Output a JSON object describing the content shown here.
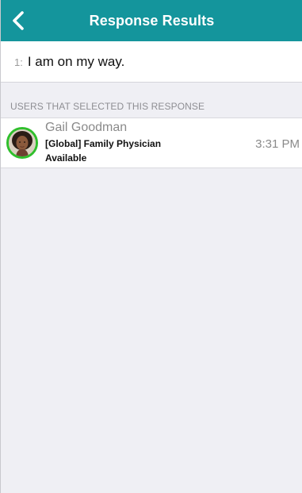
{
  "header": {
    "title": "Response Results",
    "back_icon": "chevron-left-icon",
    "background_color": "#14959c"
  },
  "response": {
    "number": "1:",
    "text": "I am on my way."
  },
  "section": {
    "label": "USERS THAT SELECTED THIS RESPONSE"
  },
  "users": [
    {
      "name": "Gail Goodman",
      "role": "[Global] Family Physician",
      "status": "Available",
      "status_color": "#2fbf2c",
      "time": "3:31 PM",
      "avatar_icon": "user-avatar"
    }
  ]
}
